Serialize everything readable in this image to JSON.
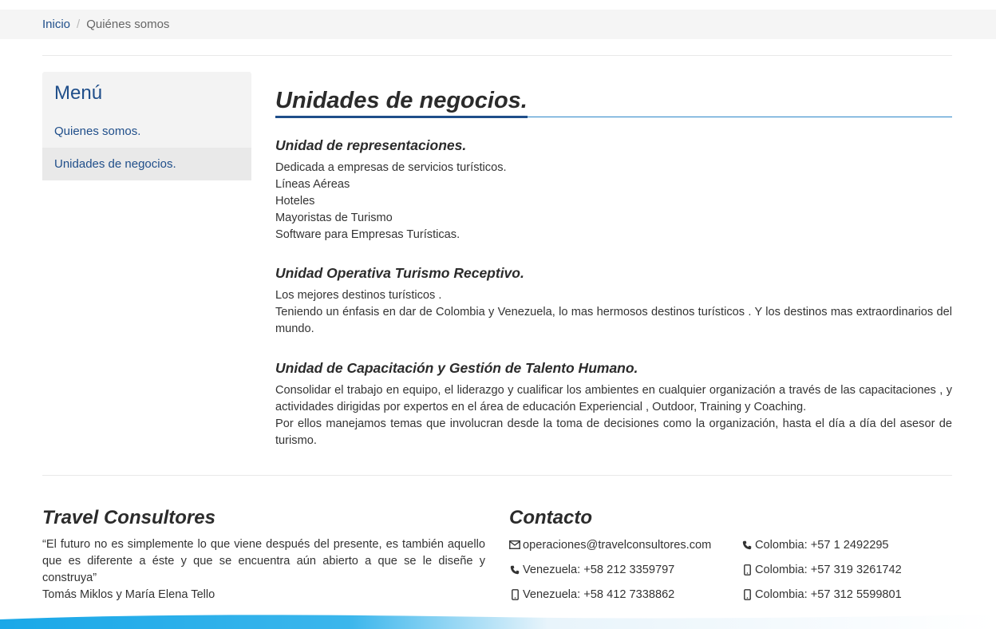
{
  "breadcrumb": {
    "home": "Inicio",
    "separator": "/",
    "current": "Quiénes somos"
  },
  "sidebar": {
    "title": "Menú",
    "items": [
      {
        "label": "Quienes somos."
      },
      {
        "label": "Unidades de negocios."
      }
    ]
  },
  "main": {
    "title": "Unidades de negocios.",
    "sections": [
      {
        "heading": "Unidad de representaciones.",
        "lines": [
          "Dedicada  a  empresas de servicios turísticos.",
          "Líneas Aéreas",
          "Hoteles",
          "Mayoristas de Turismo",
          "Software para Empresas Turísticas."
        ]
      },
      {
        "heading": "Unidad  Operativa  Turismo Receptivo.",
        "lines": [
          "Los mejores destinos turísticos .",
          "Teniendo un énfasis en dar de Colombia y Venezuela, lo mas hermosos destinos turísticos . Y los destinos mas extraordinarios del mundo."
        ]
      },
      {
        "heading": "Unidad  de Capacitación y Gestión de Talento Humano.",
        "lines": [
          "Consolidar el trabajo en equipo, el liderazgo y cualificar los ambientes en cualquier organización a través de las capacitaciones , y actividades dirigidas por expertos en el área de educación Experiencial , Outdoor, Training y Coaching.",
          "Por  ellos manejamos temas que involucran desde la toma de decisiones como la organización, hasta el  día a día   del  asesor de turismo."
        ]
      }
    ]
  },
  "footer": {
    "about": {
      "title": "Travel Consultores",
      "quote": "“El futuro no es simplemente lo que viene después del presente, es también aquello que es diferente a éste y que se encuentra aún abierto a que se le diseñe y construya”",
      "author": "Tomás Miklos y María Elena Tello"
    },
    "contact": {
      "title": "Contacto",
      "items": [
        {
          "icon": "envelope-icon",
          "text": "operaciones@travelconsultores.com"
        },
        {
          "icon": "phone-icon",
          "text": "Venezuela: +58 212 3359797"
        },
        {
          "icon": "mobile-icon",
          "text": "Venezuela: +58 412 7338862"
        },
        {
          "icon": "phone-icon",
          "text": "Colombia: +57 1 2492295"
        },
        {
          "icon": "mobile-icon",
          "text": "Colombia: +57 319 3261742"
        },
        {
          "icon": "mobile-icon",
          "text": "Colombia: +57 312 5599801"
        }
      ]
    }
  },
  "colors": {
    "link": "#1f4e8a",
    "title_accent": "#2a86c8",
    "sidebar_bg": "#f3f3f3"
  }
}
